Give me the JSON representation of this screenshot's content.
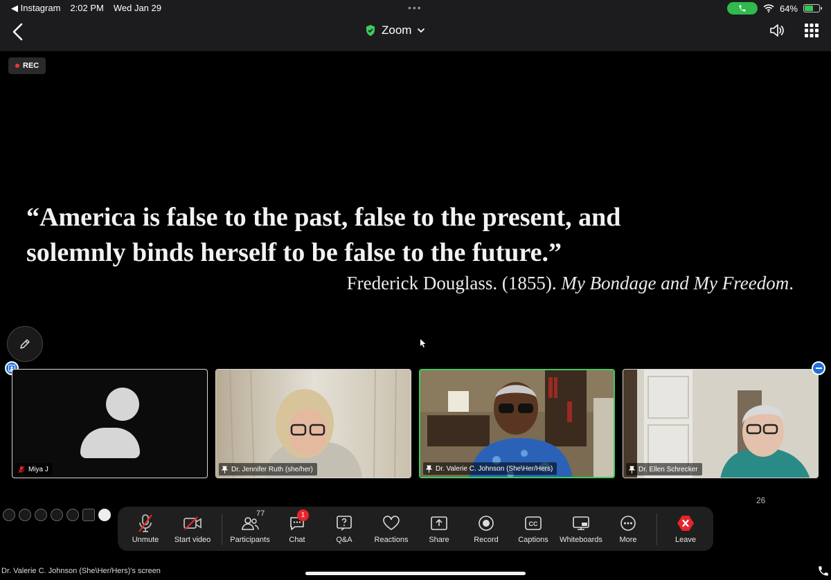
{
  "status_bar": {
    "back_app": "◀ Instagram",
    "time": "2:02 PM",
    "date": "Wed Jan 29",
    "battery": "64%",
    "battery_level": 0.64
  },
  "title_bar": {
    "title": "Zoom"
  },
  "recording": {
    "label": "REC"
  },
  "shared_screen": {
    "quote_line1": "“America is false to the past, false to the present, and",
    "quote_line2": "solemnly binds herself to be false to the future.”",
    "citation_plain": "Frederick Douglass.  (1855). ",
    "citation_title": "My Bondage and My Freedom",
    "citation_end": "."
  },
  "participants": [
    {
      "name": "Miya J",
      "muted": true
    },
    {
      "name": "Dr. Jennifer Ruth (she/her)"
    },
    {
      "name": "Dr. Valerie C. Johnson (She\\Her/Hers)",
      "active_speaker": true
    },
    {
      "name": "Dr. Ellen Schrecker"
    }
  ],
  "page_count": "26",
  "toolbar": {
    "unmute": "Unmute",
    "start_video": "Start video",
    "participants": "Participants",
    "participants_count": "77",
    "chat": "Chat",
    "chat_badge": "1",
    "qa": "Q&A",
    "reactions": "Reactions",
    "share": "Share",
    "record": "Record",
    "captions": "Captions",
    "whiteboards": "Whiteboards",
    "more": "More",
    "leave": "Leave"
  },
  "footer": {
    "screen_owner": "Dr. Valerie C. Johnson (She\\Her/Hers)'s screen"
  },
  "colors": {
    "accent_green": "#3fcb5e",
    "leave_red": "#e5252a",
    "rec_red": "#e53935",
    "badge_blue": "#1e6fd9"
  }
}
